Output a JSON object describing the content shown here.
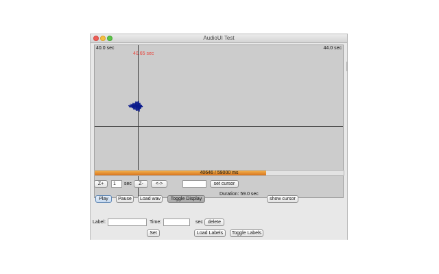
{
  "window": {
    "title": "AudioUI Test"
  },
  "waveform": {
    "start_label": "40.0 sec",
    "end_label": "44.0 sec",
    "cursor_label": "40.65 sec",
    "duration_label": "Duration: 59.0 sec"
  },
  "progress": {
    "text": "40646 / 59000 ms",
    "fraction": 0.689
  },
  "zoom_row": {
    "zoom_in_label": "Z+",
    "seconds_value": "1",
    "seconds_unit": "sec",
    "zoom_out_label": "Z-",
    "fit_label": "<->",
    "cursor_value": "",
    "set_cursor_label": "set cursor"
  },
  "controls": {
    "play_label": "Play",
    "pause_label": "Pause",
    "load_wav_label": "Load wav",
    "toggle_display_label": "Toggle Display",
    "show_cursor_label": "show cursor"
  },
  "labels_row": {
    "label_caption": "Label:",
    "label_value": "",
    "time_caption": "Time:",
    "time_value": "",
    "time_unit": "sec",
    "delete_label": "delete",
    "set_label": "Set",
    "load_labels_label": "Load Labels",
    "toggle_labels_label": "Toggle Labels"
  },
  "colors": {
    "waveform": "#0a1a8c",
    "cursor_text": "#e8433a",
    "progress_fill": "#e08a2c"
  }
}
